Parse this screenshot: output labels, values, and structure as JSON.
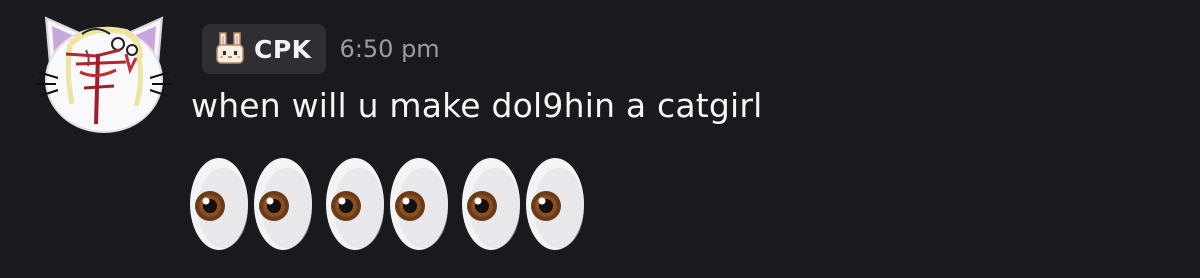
{
  "author": {
    "avatar_icon": "catgirl-avatar-icon",
    "tag_icon": "bunny-icon",
    "tag_label": "CPK"
  },
  "message": {
    "timestamp": "6:50 pm",
    "text": "when will u make dol9hin a catgirl",
    "emoji_name": "eyes",
    "emoji_count": 6
  },
  "colors": {
    "background": "#1a1a1e",
    "tag_background": "#2e2e33",
    "text": "#f4f4f6",
    "timestamp": "#9a9ba3"
  }
}
